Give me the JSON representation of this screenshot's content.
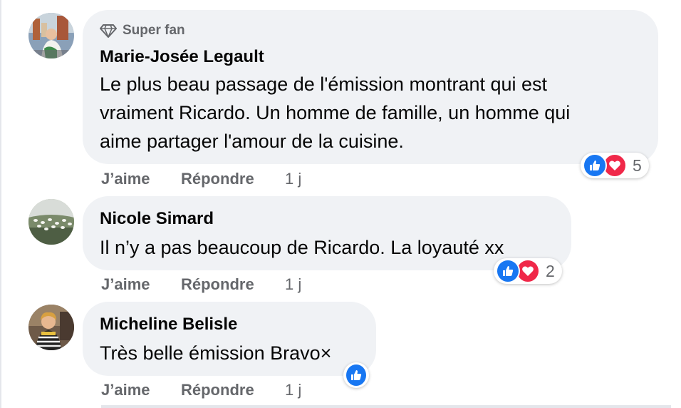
{
  "comments": [
    {
      "badge": "Super fan",
      "author": "Marie-Josée Legault",
      "text_lines": [
        "Le plus beau passage de l'émission montrant qui est",
        "vraiment Ricardo. Un homme de famille, un homme qui",
        "aime partager l'amour de la cuisine."
      ],
      "like_label": "J’aime",
      "reply_label": "Répondre",
      "time": "1 j",
      "reaction_count": "5",
      "reactions": [
        "like-icon",
        "love-icon"
      ]
    },
    {
      "author": "Nicole Simard",
      "text_lines": [
        "Il n’y a pas beaucoup de Ricardo. La loyauté xx"
      ],
      "like_label": "J’aime",
      "reply_label": "Répondre",
      "time": "1 j",
      "reaction_count": "2",
      "reactions": [
        "like-icon",
        "love-icon"
      ]
    },
    {
      "author": "Micheline Belisle",
      "text_lines": [
        "Très belle émission Bravo×"
      ],
      "like_label": "J’aime",
      "reply_label": "Répondre",
      "time": "1 j",
      "reactions": [
        "like-icon"
      ]
    }
  ],
  "colors": {
    "bubble": "#f0f2f5",
    "like_blue": "#1877f2",
    "love_red": "#f02849",
    "meta_gray": "#65676b"
  }
}
